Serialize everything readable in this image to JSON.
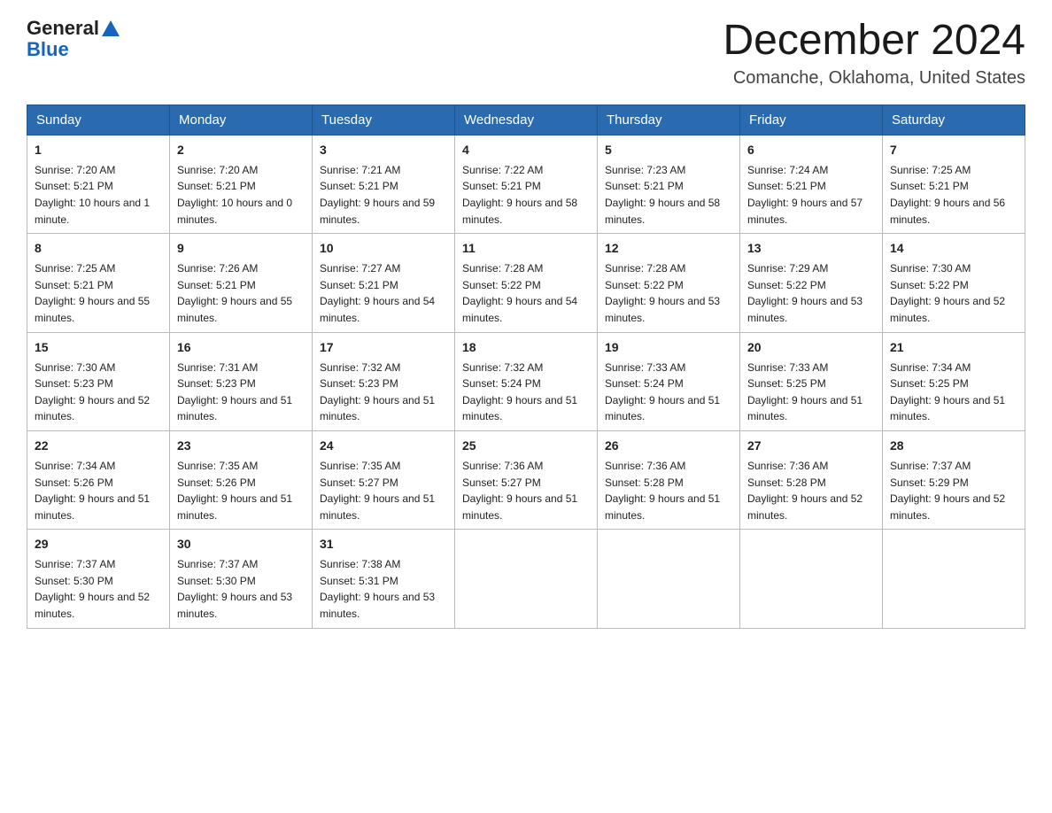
{
  "header": {
    "logo_general": "General",
    "logo_blue": "Blue",
    "month_title": "December 2024",
    "subtitle": "Comanche, Oklahoma, United States"
  },
  "days_of_week": [
    "Sunday",
    "Monday",
    "Tuesday",
    "Wednesday",
    "Thursday",
    "Friday",
    "Saturday"
  ],
  "weeks": [
    [
      {
        "day": "1",
        "sunrise": "7:20 AM",
        "sunset": "5:21 PM",
        "daylight": "10 hours and 1 minute."
      },
      {
        "day": "2",
        "sunrise": "7:20 AM",
        "sunset": "5:21 PM",
        "daylight": "10 hours and 0 minutes."
      },
      {
        "day": "3",
        "sunrise": "7:21 AM",
        "sunset": "5:21 PM",
        "daylight": "9 hours and 59 minutes."
      },
      {
        "day": "4",
        "sunrise": "7:22 AM",
        "sunset": "5:21 PM",
        "daylight": "9 hours and 58 minutes."
      },
      {
        "day": "5",
        "sunrise": "7:23 AM",
        "sunset": "5:21 PM",
        "daylight": "9 hours and 58 minutes."
      },
      {
        "day": "6",
        "sunrise": "7:24 AM",
        "sunset": "5:21 PM",
        "daylight": "9 hours and 57 minutes."
      },
      {
        "day": "7",
        "sunrise": "7:25 AM",
        "sunset": "5:21 PM",
        "daylight": "9 hours and 56 minutes."
      }
    ],
    [
      {
        "day": "8",
        "sunrise": "7:25 AM",
        "sunset": "5:21 PM",
        "daylight": "9 hours and 55 minutes."
      },
      {
        "day": "9",
        "sunrise": "7:26 AM",
        "sunset": "5:21 PM",
        "daylight": "9 hours and 55 minutes."
      },
      {
        "day": "10",
        "sunrise": "7:27 AM",
        "sunset": "5:21 PM",
        "daylight": "9 hours and 54 minutes."
      },
      {
        "day": "11",
        "sunrise": "7:28 AM",
        "sunset": "5:22 PM",
        "daylight": "9 hours and 54 minutes."
      },
      {
        "day": "12",
        "sunrise": "7:28 AM",
        "sunset": "5:22 PM",
        "daylight": "9 hours and 53 minutes."
      },
      {
        "day": "13",
        "sunrise": "7:29 AM",
        "sunset": "5:22 PM",
        "daylight": "9 hours and 53 minutes."
      },
      {
        "day": "14",
        "sunrise": "7:30 AM",
        "sunset": "5:22 PM",
        "daylight": "9 hours and 52 minutes."
      }
    ],
    [
      {
        "day": "15",
        "sunrise": "7:30 AM",
        "sunset": "5:23 PM",
        "daylight": "9 hours and 52 minutes."
      },
      {
        "day": "16",
        "sunrise": "7:31 AM",
        "sunset": "5:23 PM",
        "daylight": "9 hours and 51 minutes."
      },
      {
        "day": "17",
        "sunrise": "7:32 AM",
        "sunset": "5:23 PM",
        "daylight": "9 hours and 51 minutes."
      },
      {
        "day": "18",
        "sunrise": "7:32 AM",
        "sunset": "5:24 PM",
        "daylight": "9 hours and 51 minutes."
      },
      {
        "day": "19",
        "sunrise": "7:33 AM",
        "sunset": "5:24 PM",
        "daylight": "9 hours and 51 minutes."
      },
      {
        "day": "20",
        "sunrise": "7:33 AM",
        "sunset": "5:25 PM",
        "daylight": "9 hours and 51 minutes."
      },
      {
        "day": "21",
        "sunrise": "7:34 AM",
        "sunset": "5:25 PM",
        "daylight": "9 hours and 51 minutes."
      }
    ],
    [
      {
        "day": "22",
        "sunrise": "7:34 AM",
        "sunset": "5:26 PM",
        "daylight": "9 hours and 51 minutes."
      },
      {
        "day": "23",
        "sunrise": "7:35 AM",
        "sunset": "5:26 PM",
        "daylight": "9 hours and 51 minutes."
      },
      {
        "day": "24",
        "sunrise": "7:35 AM",
        "sunset": "5:27 PM",
        "daylight": "9 hours and 51 minutes."
      },
      {
        "day": "25",
        "sunrise": "7:36 AM",
        "sunset": "5:27 PM",
        "daylight": "9 hours and 51 minutes."
      },
      {
        "day": "26",
        "sunrise": "7:36 AM",
        "sunset": "5:28 PM",
        "daylight": "9 hours and 51 minutes."
      },
      {
        "day": "27",
        "sunrise": "7:36 AM",
        "sunset": "5:28 PM",
        "daylight": "9 hours and 52 minutes."
      },
      {
        "day": "28",
        "sunrise": "7:37 AM",
        "sunset": "5:29 PM",
        "daylight": "9 hours and 52 minutes."
      }
    ],
    [
      {
        "day": "29",
        "sunrise": "7:37 AM",
        "sunset": "5:30 PM",
        "daylight": "9 hours and 52 minutes."
      },
      {
        "day": "30",
        "sunrise": "7:37 AM",
        "sunset": "5:30 PM",
        "daylight": "9 hours and 53 minutes."
      },
      {
        "day": "31",
        "sunrise": "7:38 AM",
        "sunset": "5:31 PM",
        "daylight": "9 hours and 53 minutes."
      },
      null,
      null,
      null,
      null
    ]
  ]
}
